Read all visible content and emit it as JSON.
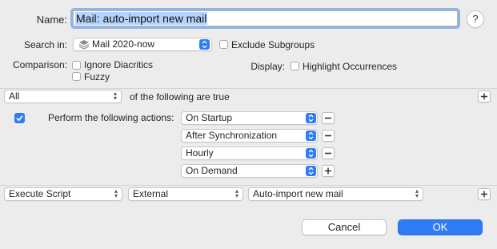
{
  "name": {
    "label": "Name:",
    "value": "Mail: auto-import new mail"
  },
  "help": {
    "label": "?"
  },
  "search_in": {
    "label": "Search in:",
    "value": "Mail 2020-now"
  },
  "exclude_subgroups": {
    "label": "Exclude Subgroups",
    "checked": false
  },
  "comparison": {
    "label": "Comparison:",
    "ignore_diacritics": "Ignore Diacritics",
    "fuzzy": "Fuzzy"
  },
  "display": {
    "label": "Display:",
    "highlight": "Highlight Occurrences"
  },
  "criteria": {
    "match_value": "All",
    "suffix": "of the following are true"
  },
  "actions": {
    "label": "Perform the following actions:",
    "checked": true,
    "triggers": [
      "On Startup",
      "After Synchronization",
      "Hourly",
      "On Demand"
    ]
  },
  "script_row": {
    "action": "Execute Script",
    "type": "External",
    "script": "Auto-import new mail"
  },
  "buttons": {
    "cancel": "Cancel",
    "ok": "OK"
  },
  "colors": {
    "accent": "#2e7cf6",
    "selection": "#b3d5fd"
  }
}
